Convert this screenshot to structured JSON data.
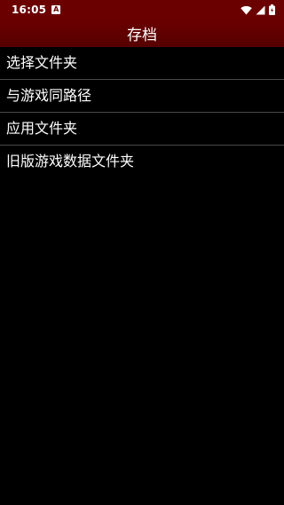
{
  "status_bar": {
    "time": "16:05",
    "notification_icon_letter": "A",
    "icons": [
      "wifi-icon",
      "signal-icon",
      "battery-icon"
    ],
    "background_color": "#6b0000"
  },
  "app_bar": {
    "title": "存档",
    "background_color": "#6b0000"
  },
  "list": {
    "items": [
      {
        "label": "选择文件夹"
      },
      {
        "label": "与游戏同路径"
      },
      {
        "label": "应用文件夹"
      },
      {
        "label": "旧版游戏数据文件夹"
      }
    ]
  }
}
